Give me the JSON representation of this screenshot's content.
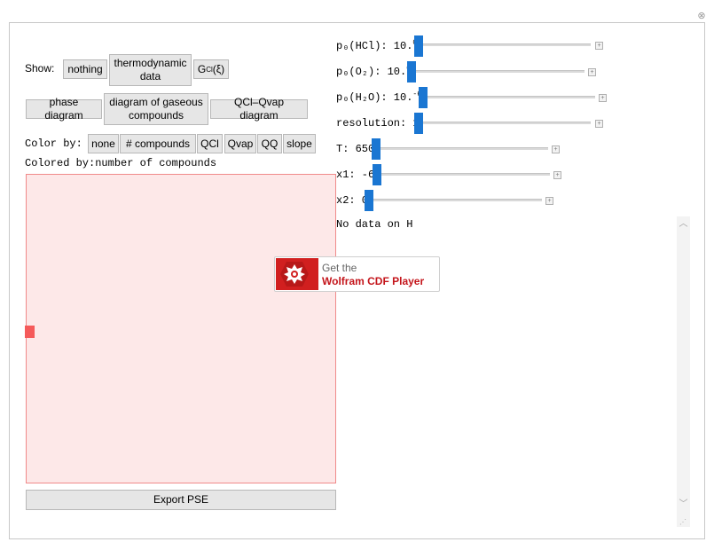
{
  "show": {
    "label": "Show:",
    "options": [
      "nothing",
      "thermodynamic data",
      "G"
    ],
    "g_subscript": "Cl",
    "g_arg": "(ξ)"
  },
  "diagram_buttons": [
    "phase diagram",
    "diagram of gaseous compounds",
    "QCl–Qvap diagram"
  ],
  "color_by": {
    "label": "Color by:",
    "options": [
      "none",
      "# compounds",
      "QCl",
      "Qvap",
      "QQ",
      "slope"
    ]
  },
  "colored_by": {
    "label": "Colored by:",
    "value": "number of compounds"
  },
  "export_label": "Export PSE",
  "controls": [
    {
      "label": "p₀(HCl): 10.",
      "exp": "0"
    },
    {
      "label": "p₀(O₂): 10.",
      "exp": "0"
    },
    {
      "label": "p₀(H₂O): 10.",
      "exp": "-6"
    },
    {
      "label": "resolution: 1",
      "exp": ""
    },
    {
      "label": "T: 650",
      "exp": ""
    },
    {
      "label": "x1: -6",
      "exp": ""
    },
    {
      "label": "x2: 0",
      "exp": ""
    }
  ],
  "message": "No data on H",
  "cdf_player": {
    "line1": "Get the",
    "line2": "Wolfram CDF Player"
  },
  "colors": {
    "accent": "#1a76d2",
    "plot_fill": "#fde8e8",
    "marker": "#f55a5a",
    "cdf_red": "#d11f1f"
  }
}
